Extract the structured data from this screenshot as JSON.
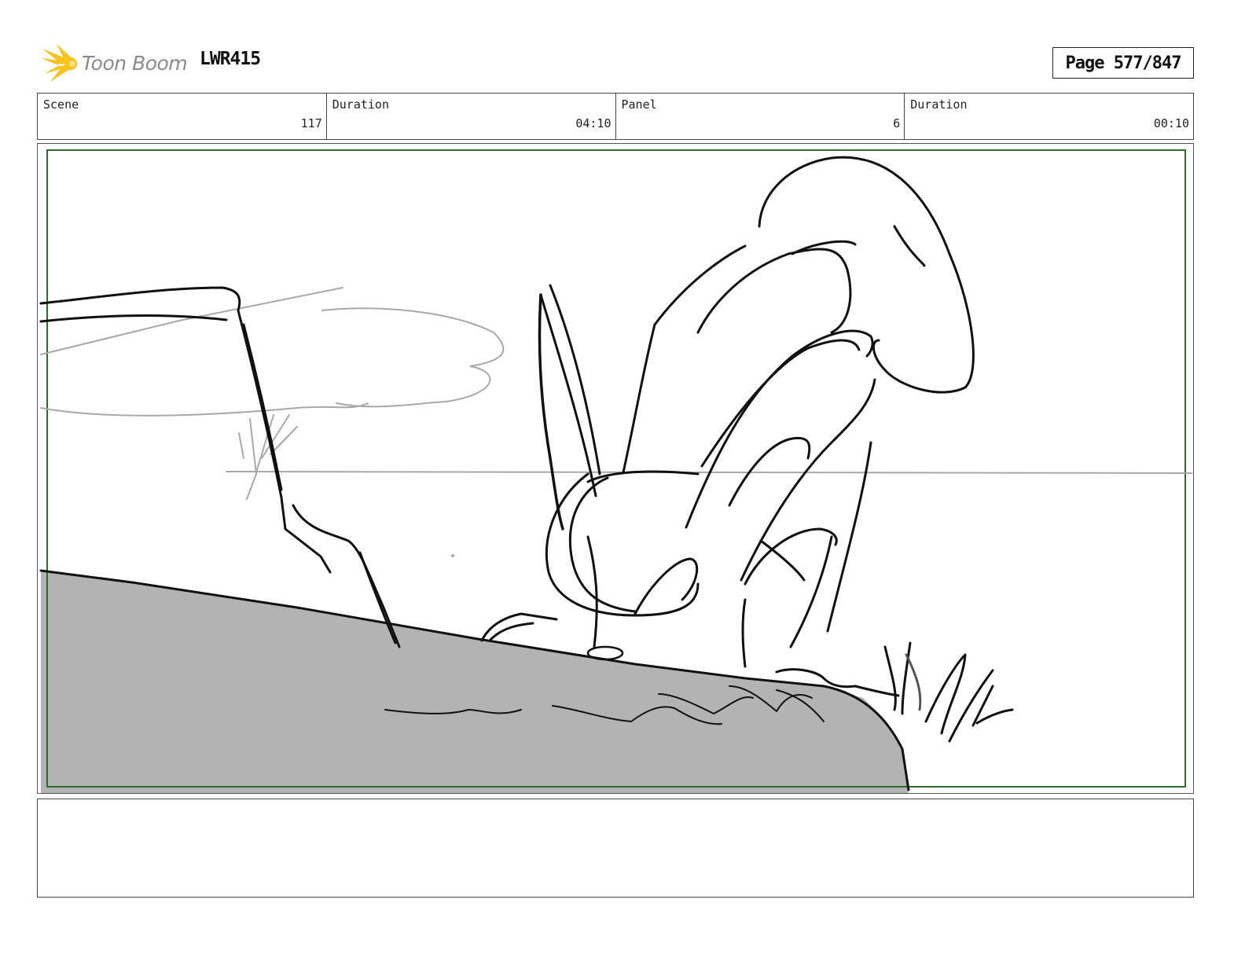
{
  "header": {
    "logo_text": "Toon Boom",
    "project_code": "LWR415",
    "page_label": "Page 577/847"
  },
  "info": {
    "scene_label": "Scene",
    "scene_value": "117",
    "scene_duration_label": "Duration",
    "scene_duration_value": "04:10",
    "panel_label": "Panel",
    "panel_value": "6",
    "panel_duration_label": "Duration",
    "panel_duration_value": "00:10"
  },
  "colors": {
    "safe_frame": "#2e6b2e",
    "ground_fill": "#b3b3b3",
    "sketch_gray": "#a8a8a8",
    "logo_yellow": "#f6c21b"
  },
  "icons": {
    "logo": "toon-boom-star-icon"
  },
  "notes": {
    "dialogue": "",
    "action": ""
  }
}
